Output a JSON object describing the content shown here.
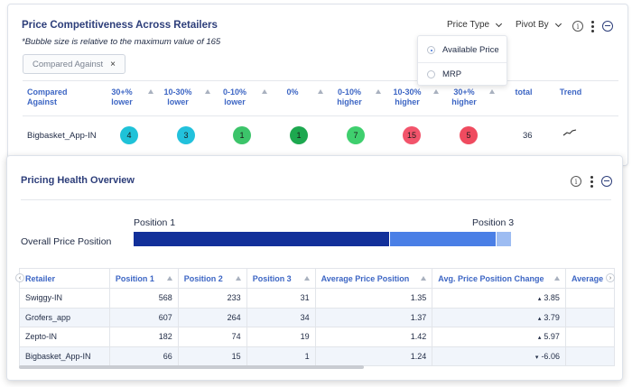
{
  "competitiveness": {
    "title": "Price Competitiveness Across Retailers",
    "subtitle": "*Bubble size is relative to the maximum value of 165",
    "filter_chip": "Compared Against",
    "filter_chip_close": "×",
    "price_type_label": "Price Type",
    "pivot_by_label": "Pivot By",
    "info_icon": "i",
    "dropdown": {
      "options": [
        "Available Price",
        "MRP"
      ],
      "selected": "Available Price"
    },
    "columns": [
      "Compared Against",
      "30+% lower",
      "10-30% lower",
      "0-10% lower",
      "0%",
      "0-10% higher",
      "10-30% higher",
      "30+% higher",
      "total",
      "Trend"
    ],
    "row": {
      "label": "Bigbasket_App-IN",
      "bubbles": [
        {
          "value": "4",
          "color": "#1fc2d8"
        },
        {
          "value": "3",
          "color": "#22c1dc"
        },
        {
          "value": "1",
          "color": "#3cc46a"
        },
        {
          "value": "1",
          "color": "#1da84f"
        },
        {
          "value": "7",
          "color": "#3fcf6e"
        },
        {
          "value": "15",
          "color": "#f2546b"
        },
        {
          "value": "5",
          "color": "#ef4b5f"
        }
      ],
      "total": "36"
    }
  },
  "health": {
    "title": "Pricing Health Overview",
    "overall_label": "Overall Price Position",
    "position_start_label": "Position 1",
    "position_end_label": "Position 3",
    "bar_segments": [
      {
        "share": 0.678,
        "color": "#12309a"
      },
      {
        "share": 0.281,
        "color": "#4a7fe6"
      },
      {
        "share": 0.041,
        "color": "#9dbcf2"
      }
    ],
    "table": {
      "headers": [
        "Retailer",
        "Position 1",
        "Position 2",
        "Position 3",
        "Average Price Position",
        "Avg. Price Position Change",
        "Average"
      ],
      "rows": [
        {
          "retailer": "Swiggy-IN",
          "p1": "568",
          "p2": "233",
          "p3": "31",
          "avg": "1.35",
          "change": "3.85",
          "dir": "up"
        },
        {
          "retailer": "Grofers_app",
          "p1": "607",
          "p2": "264",
          "p3": "34",
          "avg": "1.37",
          "change": "3.79",
          "dir": "up"
        },
        {
          "retailer": "Zepto-IN",
          "p1": "182",
          "p2": "74",
          "p3": "19",
          "avg": "1.42",
          "change": "5.97",
          "dir": "up"
        },
        {
          "retailer": "Bigbasket_App-IN",
          "p1": "66",
          "p2": "15",
          "p3": "1",
          "avg": "1.24",
          "change": "-6.06",
          "dir": "down"
        }
      ]
    }
  }
}
